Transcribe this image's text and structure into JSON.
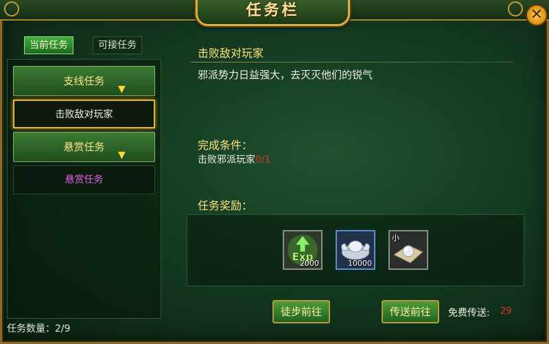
{
  "window": {
    "title": "任务栏"
  },
  "tabs": {
    "current": "当前任务",
    "available": "可接任务"
  },
  "categories": [
    {
      "label": "支线任务",
      "items": [
        "击败敌对玩家"
      ]
    },
    {
      "label": "悬赏任务",
      "items": [
        "悬赏任务"
      ]
    }
  ],
  "footer": {
    "task_count": "任务数量：2/9"
  },
  "detail": {
    "name": "击败敌对玩家",
    "description": "邪派势力日益强大，去灭灭他们的锐气",
    "complete_label": "完成条件：",
    "condition_text": "击败邪派玩家",
    "condition_progress": "0/1",
    "reward_label": "任务奖励："
  },
  "rewards": [
    {
      "icon": "exp-icon",
      "qty": "2000",
      "tag": ""
    },
    {
      "icon": "silver-ingot-icon",
      "qty": "10000",
      "tag": ""
    },
    {
      "icon": "pearl-item-icon",
      "qty": "",
      "tag": "小"
    }
  ],
  "actions": {
    "walk": "徒步前往",
    "teleport": "传送前往",
    "free_label": "免费传送:",
    "free_count": "29"
  },
  "colors": {
    "highlight_gold": "#ffe07a",
    "progress_red": "#e3302a",
    "bounty_purple": "#e062e6"
  }
}
